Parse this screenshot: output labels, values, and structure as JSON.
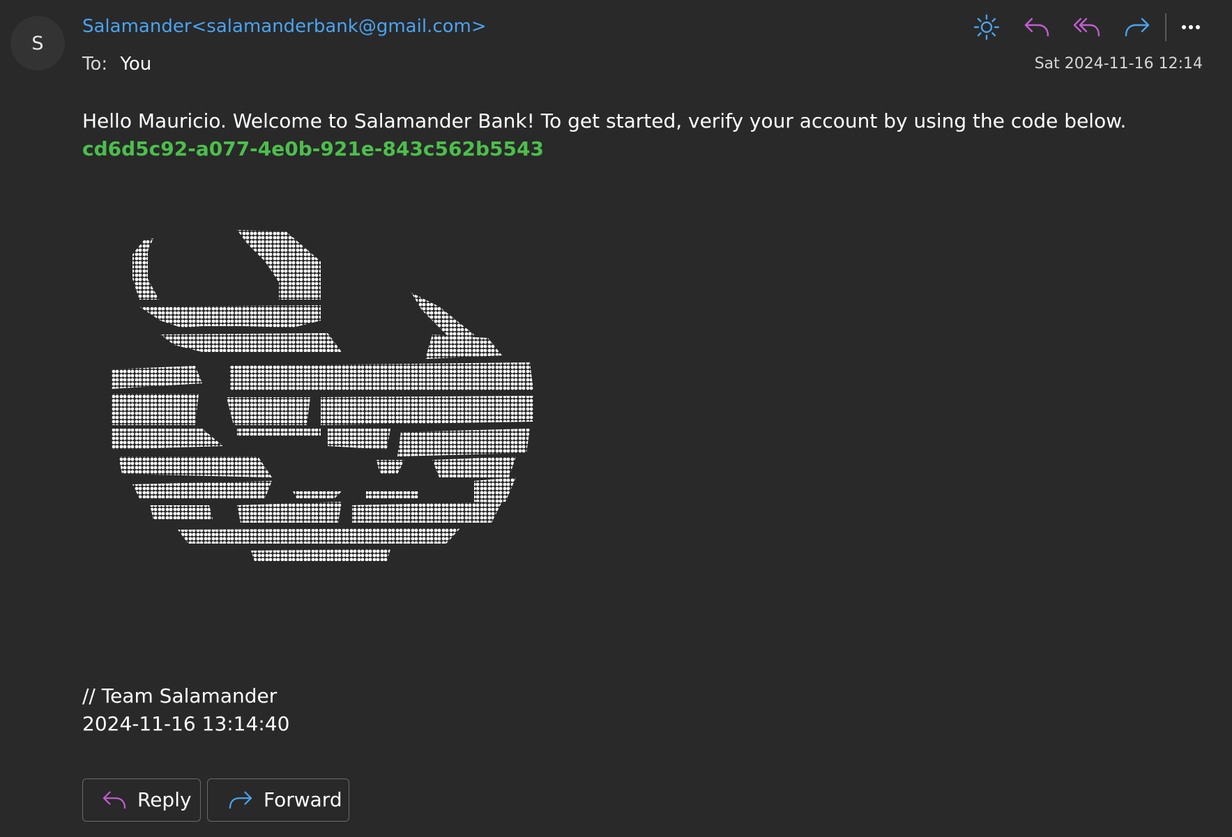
{
  "message": {
    "avatar_initial": "S",
    "sender": "Salamander<salamanderbank@gmail.com>",
    "to_label": "To:",
    "to_value": "You",
    "date": "Sat 2024-11-16 12:14",
    "greeting": "Hello Mauricio. Welcome to Salamander Bank! To get started, verify your account by using the code below.",
    "code": "cd6d5c92-a077-4e0b-921e-843c562b5543",
    "signoff": "// Team Salamander",
    "timestamp": "2024-11-16 13:14:40"
  },
  "toolbar": {
    "icons": [
      "sun-icon",
      "reply-icon",
      "reply-all-icon",
      "forward-icon",
      "more-icon"
    ]
  },
  "actions": {
    "reply_label": "Reply",
    "forward_label": "Forward"
  },
  "colors": {
    "background": "#292929",
    "sender_link": "#4aa3f0",
    "code": "#4cbf4c",
    "reply_icon": "#c25ed1",
    "forward_icon": "#4aa3f0"
  }
}
